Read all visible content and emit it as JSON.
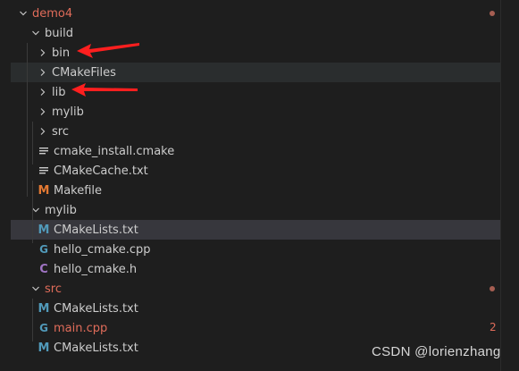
{
  "tree": [
    {
      "label": "demo4",
      "depth": 0,
      "kind": "folder-open",
      "color": "#e06c5a",
      "dot": true
    },
    {
      "label": "build",
      "depth": 1,
      "kind": "folder-open"
    },
    {
      "label": "bin",
      "depth": 2,
      "kind": "folder-closed"
    },
    {
      "label": "CMakeFiles",
      "depth": 2,
      "kind": "folder-closed",
      "state": "hover"
    },
    {
      "label": "lib",
      "depth": 2,
      "kind": "folder-closed"
    },
    {
      "label": "mylib",
      "depth": 2,
      "kind": "folder-closed"
    },
    {
      "label": "src",
      "depth": 2,
      "kind": "folder-closed"
    },
    {
      "label": "cmake_install.cmake",
      "depth": 2,
      "kind": "file",
      "icon": "lines-icon"
    },
    {
      "label": "CMakeCache.txt",
      "depth": 2,
      "kind": "file",
      "icon": "lines-icon"
    },
    {
      "label": "Makefile",
      "depth": 2,
      "kind": "file",
      "icon": "makefile-icon"
    },
    {
      "label": "mylib",
      "depth": 1,
      "kind": "folder-open"
    },
    {
      "label": "CMakeLists.txt",
      "depth": 2,
      "kind": "file",
      "icon": "cmake-icon",
      "state": "selected"
    },
    {
      "label": "hello_cmake.cpp",
      "depth": 2,
      "kind": "file",
      "icon": "cpp-icon"
    },
    {
      "label": "hello_cmake.h",
      "depth": 2,
      "kind": "file",
      "icon": "c-header-icon"
    },
    {
      "label": "src",
      "depth": 1,
      "kind": "folder-open",
      "color": "#e06c5a",
      "dot": true
    },
    {
      "label": "CMakeLists.txt",
      "depth": 2,
      "kind": "file",
      "icon": "cmake-icon"
    },
    {
      "label": "main.cpp",
      "depth": 2,
      "kind": "file",
      "icon": "cpp-icon",
      "color": "#e06c5a",
      "badge": "2"
    },
    {
      "label": "CMakeLists.txt",
      "depth": 1,
      "kind": "file",
      "icon": "cmake-icon"
    }
  ],
  "watermark": "CSDN @lorienzhang",
  "colors": {
    "background": "#1e1e1e",
    "text": "#cccccc",
    "git_modified": "#e06c5a",
    "cmake_icon": "#519aba",
    "cpp_icon": "#519aba",
    "header_icon": "#a074c4",
    "makefile_icon": "#e37933",
    "annotation_arrow": "#ff1f1f"
  },
  "annotations": [
    {
      "points_to": "bin"
    },
    {
      "points_to": "lib"
    }
  ]
}
